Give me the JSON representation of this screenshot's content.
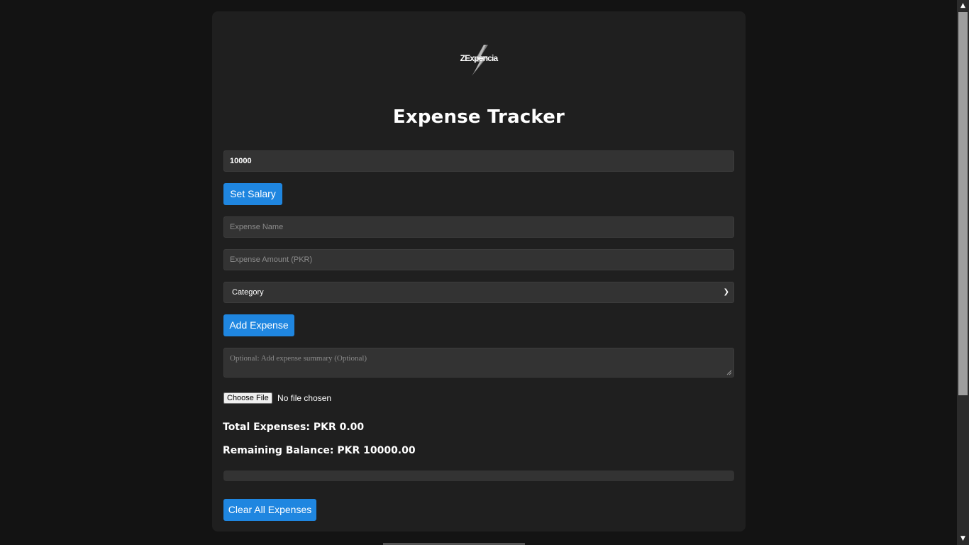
{
  "app": {
    "logo_text": "ZExpencia",
    "title": "Expense Tracker"
  },
  "salary": {
    "value": "10000",
    "button_label": "Set Salary"
  },
  "expense": {
    "name_placeholder": "Expense Name",
    "amount_placeholder": "Expense Amount (PKR)",
    "category_selected": "Category",
    "add_button_label": "Add Expense",
    "summary_placeholder": "Optional: Add expense summary (Optional)"
  },
  "file": {
    "button_label": "Choose File",
    "status": "No file chosen"
  },
  "totals": {
    "total_expenses": "Total Expenses: PKR 0.00",
    "remaining_balance": "Remaining Balance: PKR 10000.00"
  },
  "progress": {
    "fraction": 0
  },
  "actions": {
    "clear_button_label": "Clear All Expenses"
  },
  "colors": {
    "accent": "#1f86e0",
    "card_bg": "#1f1f1f",
    "page_bg": "#131313",
    "input_bg": "#333333"
  },
  "icons": {
    "logo": "lightning-bolt-icon",
    "select_arrow": "chevron-down-icon",
    "scroll_up": "scroll-up-arrow-icon",
    "scroll_down": "scroll-down-arrow-icon"
  }
}
